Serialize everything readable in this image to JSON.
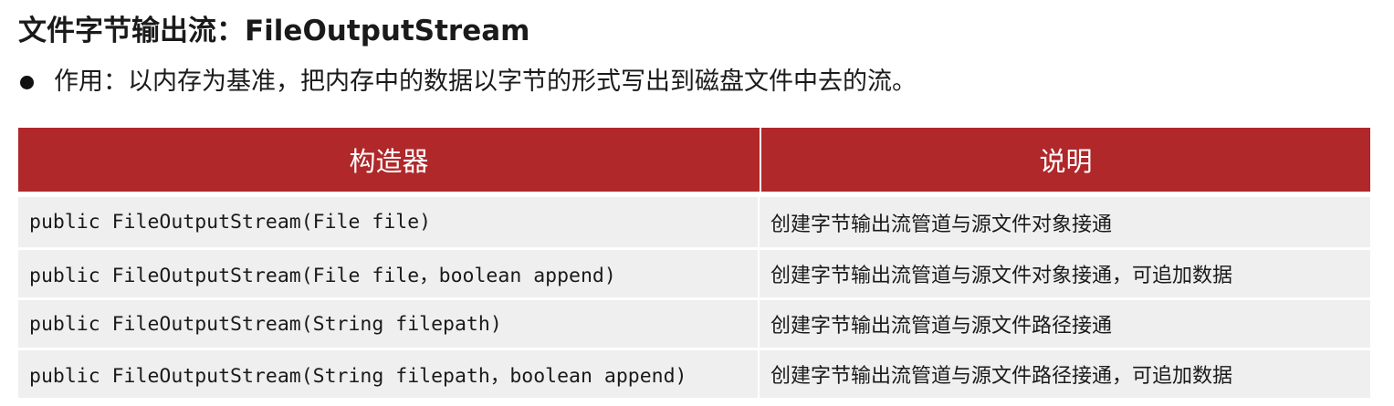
{
  "title": "文件字节输出流：FileOutputStream",
  "bullet": "作用：以内存为基准，把内存中的数据以字节的形式写出到磁盘文件中去的流。",
  "table": {
    "headers": [
      "构造器",
      "说明"
    ],
    "rows": [
      {
        "constructor": "public FileOutputStream(File file)",
        "description": "创建字节输出流管道与源文件对象接通"
      },
      {
        "constructor": "public FileOutputStream(File file，boolean append)",
        "description": "创建字节输出流管道与源文件对象接通，可追加数据"
      },
      {
        "constructor": "public FileOutputStream(String filepath)",
        "description": "创建字节输出流管道与源文件路径接通"
      },
      {
        "constructor": "public FileOutputStream(String filepath，boolean append)",
        "description": "创建字节输出流管道与源文件路径接通，可追加数据"
      }
    ]
  }
}
